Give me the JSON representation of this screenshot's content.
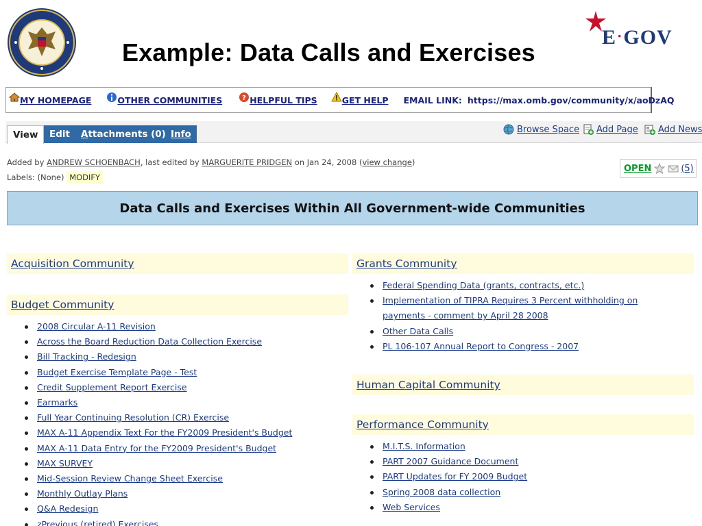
{
  "slide": {
    "title": "Example:  Data Calls and Exercises",
    "egov_text": "E·GOV"
  },
  "topbar": {
    "links": [
      {
        "label": "MY HOMEPAGE",
        "icon": "home-icon"
      },
      {
        "label": "OTHER COMMUNITIES",
        "icon": "info-icon"
      },
      {
        "label": "HELPFUL TIPS",
        "icon": "question-icon"
      },
      {
        "label": "GET HELP",
        "icon": "warning-icon"
      }
    ],
    "email_label": "EMAIL LINK:",
    "email_url": "https://max.omb.gov/community/x/aoDzAQ"
  },
  "tabs": {
    "view": "View",
    "edit": "Edit",
    "attachments_prefix": "A",
    "attachments_rest": "ttachments (0)",
    "info": "Info"
  },
  "actions": {
    "browse": "Browse Space",
    "add_page": "Add Page",
    "add_news": "Add News"
  },
  "meta": {
    "added_by_prefix": "Added by",
    "added_by": "ANDREW SCHOENBACH",
    "edited_by_prefix": ", last edited by",
    "edited_by": "MARGUERITE PRIDGEN",
    "date_text": "on Jan 24, 2008  (",
    "view_change": "view change",
    "close_paren": ")",
    "labels_prefix": "Labels: (None)",
    "label_modify": "MODIFY",
    "open_label": "OPEN",
    "open_count": "(5)"
  },
  "banner": "Data Calls and Exercises Within All Government-wide Communities",
  "left": {
    "acquisition": {
      "title": "Acquisition Community"
    },
    "budget": {
      "title": "Budget Community",
      "items": [
        "2008 Circular A-11 Revision",
        "Across the Board Reduction Data Collection Exercise",
        "Bill Tracking - Redesign",
        "Budget Exercise Template Page - Test",
        "Credit Supplement Report Exercise",
        "Earmarks",
        "Full Year Continuing Resolution (CR) Exercise",
        "MAX A-11 Appendix Text For the FY2009 President's Budget",
        "MAX A-11 Data Entry for the FY2009 President's Budget",
        "MAX SURVEY",
        "Mid-Session Review Change Sheet Exercise",
        "Monthly Outlay Plans",
        "Q&A Redesign",
        "zPrevious (retired) Exercises"
      ]
    }
  },
  "right": {
    "grants": {
      "title": "Grants Community",
      "items": [
        "Federal Spending Data (grants, contracts, etc.)",
        "Implementation of TIPRA Requires 3 Percent withholding on payments - comment by April 28 2008",
        "Other Data Calls",
        "PL 106-107 Annual Report to Congress - 2007"
      ]
    },
    "human_capital": {
      "title": "Human Capital Community"
    },
    "performance": {
      "title": "Performance Community",
      "items": [
        "M.I.T.S. Information",
        "PART 2007 Guidance Document",
        "PART Updates for FY 2009 Budget",
        "Spring 2008 data collection",
        "Web Services"
      ]
    }
  },
  "colors": {
    "link": "#1a3a8a",
    "tab_blue": "#2f6aa6",
    "banner_bg": "#b5d6ea",
    "section_bg": "#fffbdc",
    "open_green": "#0a9a2a"
  }
}
